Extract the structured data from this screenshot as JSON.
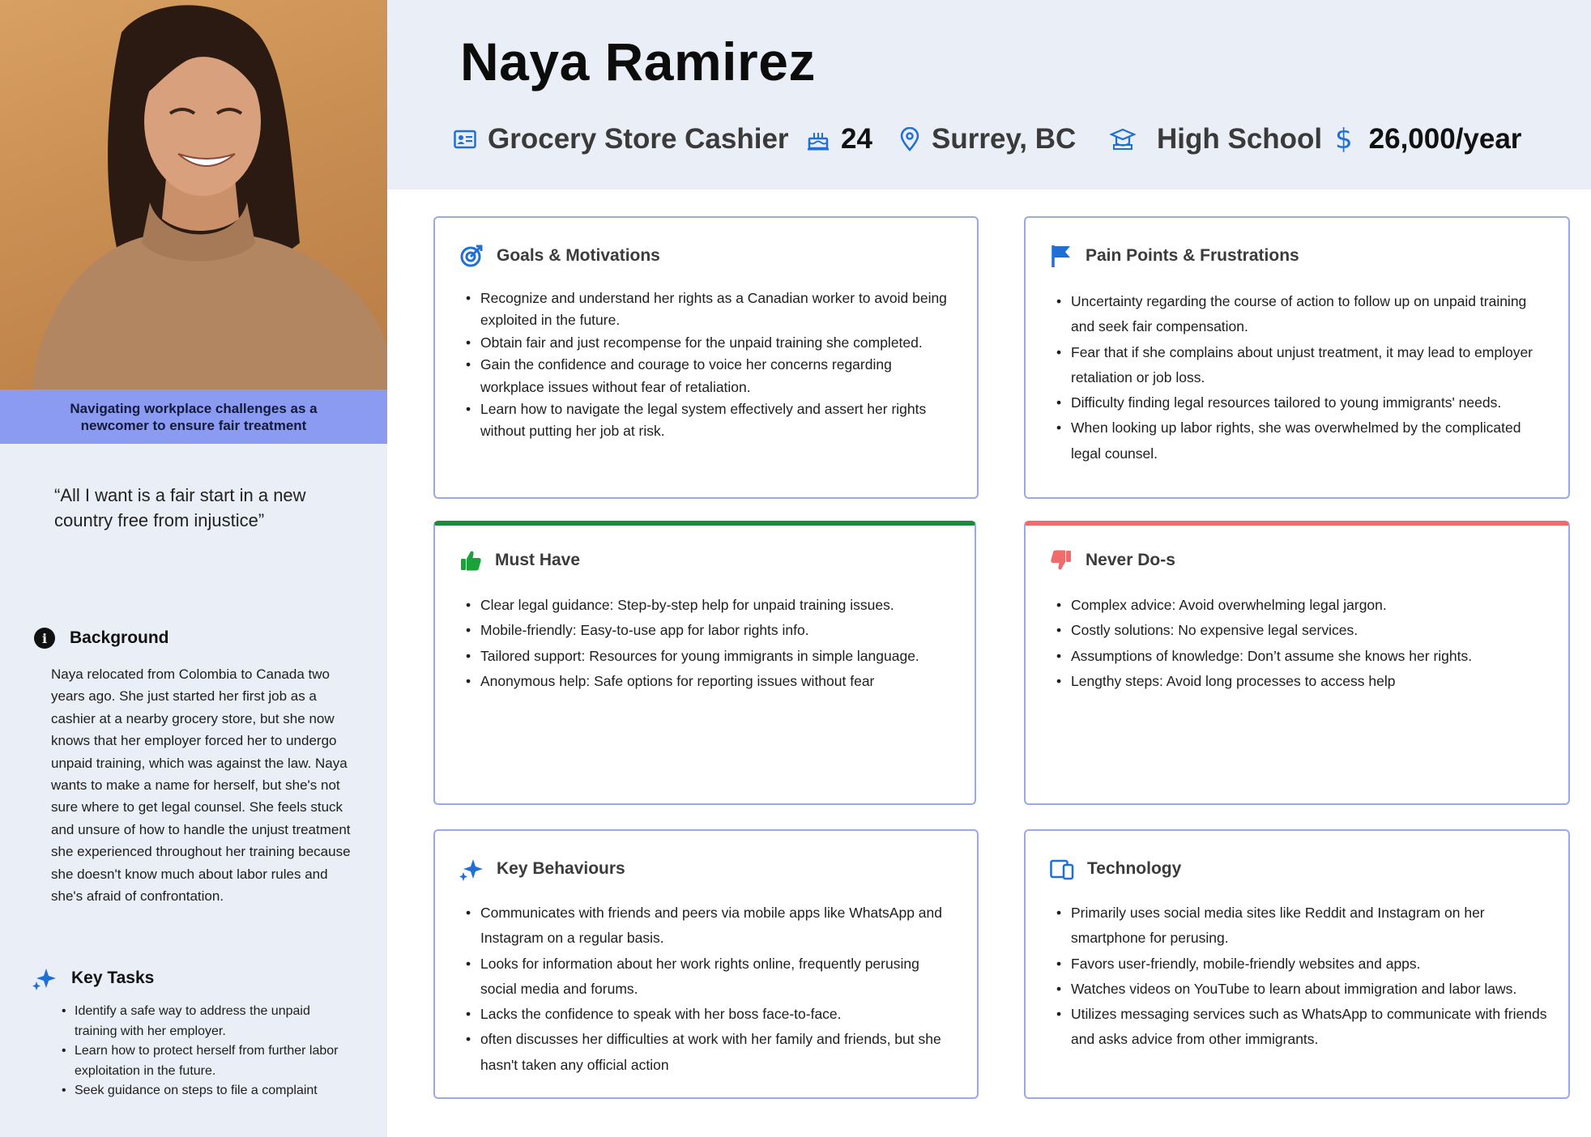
{
  "profile": {
    "caption": "Navigating workplace challenges as a newcomer to ensure fair treatment",
    "quote": "“All I want is a fair start in a new country free from injustice”"
  },
  "background": {
    "title": "Background",
    "text": "Naya relocated from Colombia to Canada two years ago. She just started her first job as a cashier at a nearby grocery store, but she now knows that her employer forced her to undergo unpaid training, which was against the law. Naya wants to make a name for herself, but she's not sure where to get legal counsel. She feels stuck and unsure of how to handle the unjust treatment she experienced throughout her training because she doesn't know much about labor rules and she's afraid of confrontation."
  },
  "key_tasks": {
    "title": "Key Tasks",
    "items": [
      "Identify a safe way to address the unpaid training with her employer.",
      "Learn how to protect herself from further labor exploitation in the future.",
      "Seek guidance on steps to file a complaint"
    ]
  },
  "header": {
    "name": "Naya Ramirez",
    "occupation": "Grocery Store Cashier",
    "age": "24",
    "location": "Surrey, BC",
    "education": "High School",
    "income": "26,000/year"
  },
  "goals": {
    "title": "Goals & Motivations",
    "items": [
      "Recognize and understand her rights as a Canadian worker to avoid being exploited in the future.",
      "Obtain fair and just recompense for the unpaid training she completed.",
      "Gain the confidence and courage to voice her concerns regarding workplace issues without fear of retaliation.",
      "Learn how to navigate the legal system effectively and assert her rights without putting her job at risk."
    ]
  },
  "pain_points": {
    "title": "Pain Points & Frustrations",
    "items": [
      "Uncertainty regarding the course of action to follow up on unpaid training and seek fair compensation.",
      "Fear that if she complains about unjust treatment, it may lead to employer retaliation or job loss.",
      "Difficulty finding legal resources tailored to young immigrants' needs.",
      "When looking up labor rights, she was overwhelmed by the complicated legal counsel."
    ]
  },
  "must_have": {
    "title": "Must Have",
    "items": [
      "Clear legal guidance: Step-by-step help for unpaid training issues.",
      "Mobile-friendly: Easy-to-use app for labor rights info.",
      "Tailored support: Resources for young immigrants in simple language.",
      "Anonymous help: Safe options for reporting issues without fear"
    ]
  },
  "never_dos": {
    "title": "Never Do-s",
    "items": [
      "Complex advice: Avoid overwhelming legal jargon.",
      "Costly solutions: No expensive legal services.",
      "Assumptions of knowledge: Don’t assume she knows her rights.",
      "Lengthy steps: Avoid long processes to access help"
    ]
  },
  "key_behaviours": {
    "title": "Key Behaviours",
    "items": [
      "Communicates with friends and peers via mobile apps like WhatsApp and Instagram on a regular basis.",
      "Looks for information about her work rights online, frequently perusing social media and forums.",
      "Lacks the confidence to speak with her boss face-to-face.",
      "often discusses her difficulties at work with her family and friends, but she hasn't taken any official action"
    ]
  },
  "technology": {
    "title": "Technology",
    "items": [
      "Primarily uses social media sites like Reddit and Instagram on her smartphone for perusing.",
      "Favors user-friendly, mobile-friendly websites and apps.",
      "Watches videos on YouTube to learn about immigration and labor laws.",
      "Utilizes messaging services such as WhatsApp to communicate with friends and asks advice from other immigrants."
    ]
  },
  "colors": {
    "accent_blue": "#1f6fd6",
    "card_border": "#9aa8ee",
    "must_have_bar": "#1c8a3a",
    "never_do_bar": "#f06b6b",
    "caption_bg": "#8c9bf2",
    "panel_bg": "#eaeef6"
  }
}
